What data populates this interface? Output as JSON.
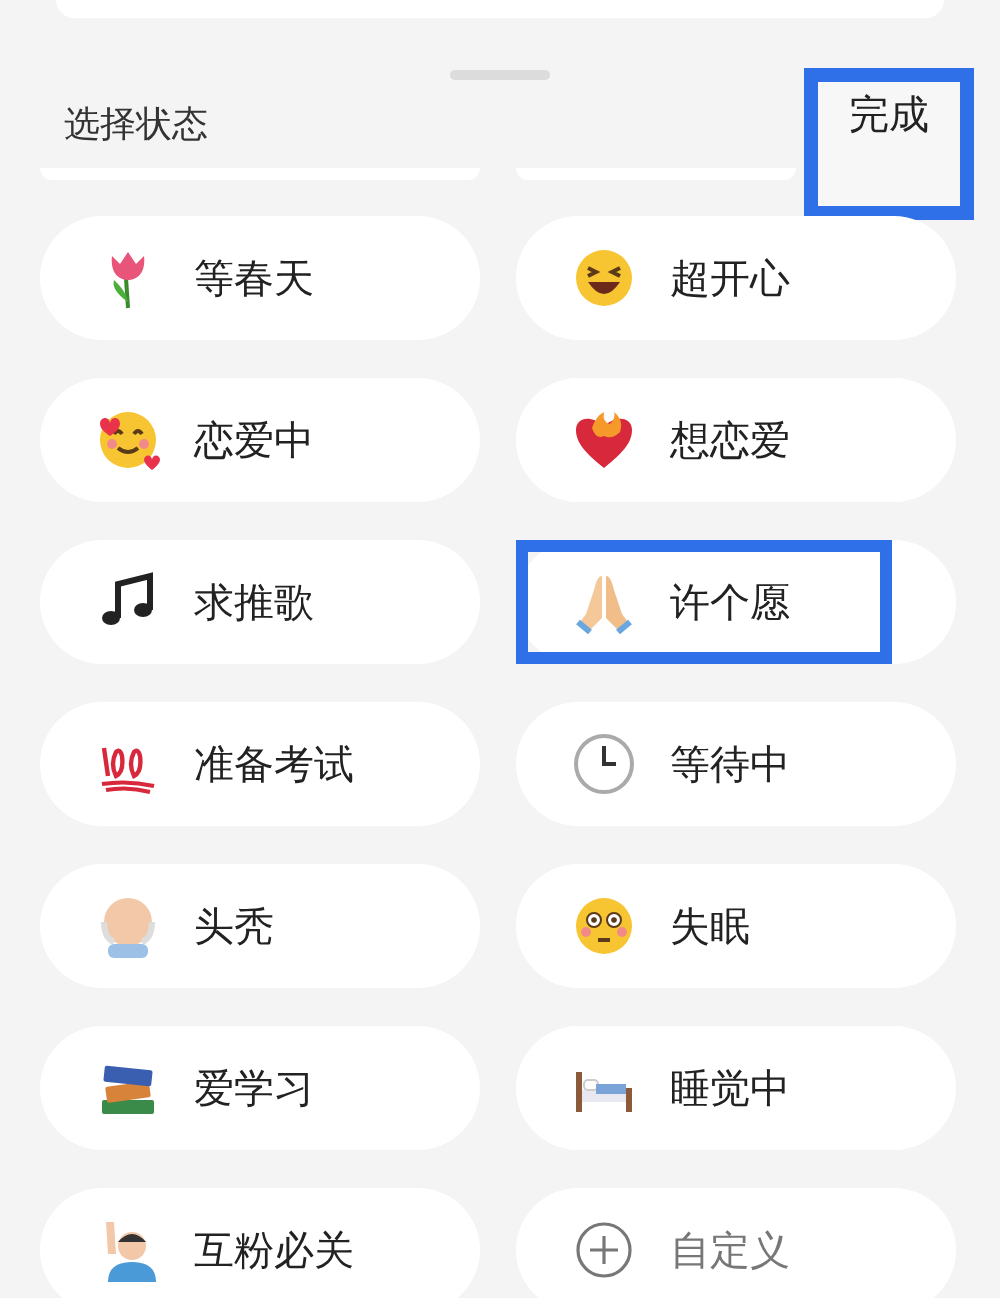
{
  "header": {
    "title": "选择状态",
    "done_button": {
      "label": "完成",
      "highlighted": true
    }
  },
  "statuses": [
    {
      "kind": "status",
      "label": "等春天",
      "highlighted": false
    },
    {
      "kind": "status",
      "label": "超开心",
      "highlighted": false
    },
    {
      "kind": "status",
      "label": "恋爱中",
      "highlighted": false
    },
    {
      "kind": "status",
      "label": "想恋爱",
      "highlighted": false
    },
    {
      "kind": "status",
      "label": "求推歌",
      "highlighted": false
    },
    {
      "kind": "status",
      "label": "许个愿",
      "highlighted": true
    },
    {
      "kind": "status",
      "label": "准备考试",
      "highlighted": false
    },
    {
      "kind": "status",
      "label": "等待中",
      "highlighted": false
    },
    {
      "kind": "status",
      "label": "头秃",
      "highlighted": false
    },
    {
      "kind": "status",
      "label": "失眠",
      "highlighted": false
    },
    {
      "kind": "status",
      "label": "爱学习",
      "highlighted": false
    },
    {
      "kind": "status",
      "label": "睡觉中",
      "highlighted": false
    },
    {
      "kind": "status",
      "label": "互粉必关",
      "highlighted": false
    },
    {
      "kind": "add",
      "label": "自定义",
      "highlighted": false
    }
  ]
}
